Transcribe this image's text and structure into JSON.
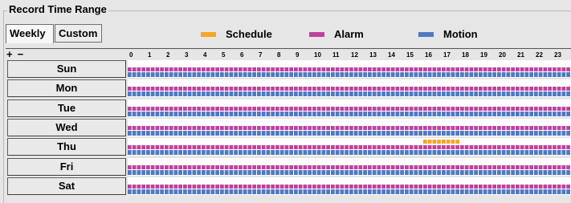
{
  "group": {
    "title": "Record Time Range"
  },
  "tabs": [
    {
      "label": "Weekly",
      "selected": true
    },
    {
      "label": "Custom",
      "selected": false
    }
  ],
  "legend": [
    {
      "label": "Schedule",
      "color": "#f5a623"
    },
    {
      "label": "Alarm",
      "color": "#c040a0"
    },
    {
      "label": "Motion",
      "color": "#4f79c2"
    }
  ],
  "zoom": {
    "plus": "+",
    "minus": "−"
  },
  "hours": [
    "0",
    "1",
    "2",
    "3",
    "4",
    "5",
    "6",
    "7",
    "8",
    "9",
    "10",
    "11",
    "12",
    "13",
    "14",
    "15",
    "16",
    "17",
    "18",
    "19",
    "20",
    "21",
    "22",
    "23"
  ],
  "days": [
    {
      "label": "Sun",
      "schedule_hours": []
    },
    {
      "label": "Mon",
      "schedule_hours": []
    },
    {
      "label": "Tue",
      "schedule_hours": []
    },
    {
      "label": "Wed",
      "schedule_hours": []
    },
    {
      "label": "Thu",
      "schedule_hours": [
        [
          16,
          18
        ]
      ]
    },
    {
      "label": "Fri",
      "schedule_hours": []
    },
    {
      "label": "Sat",
      "schedule_hours": []
    }
  ]
}
